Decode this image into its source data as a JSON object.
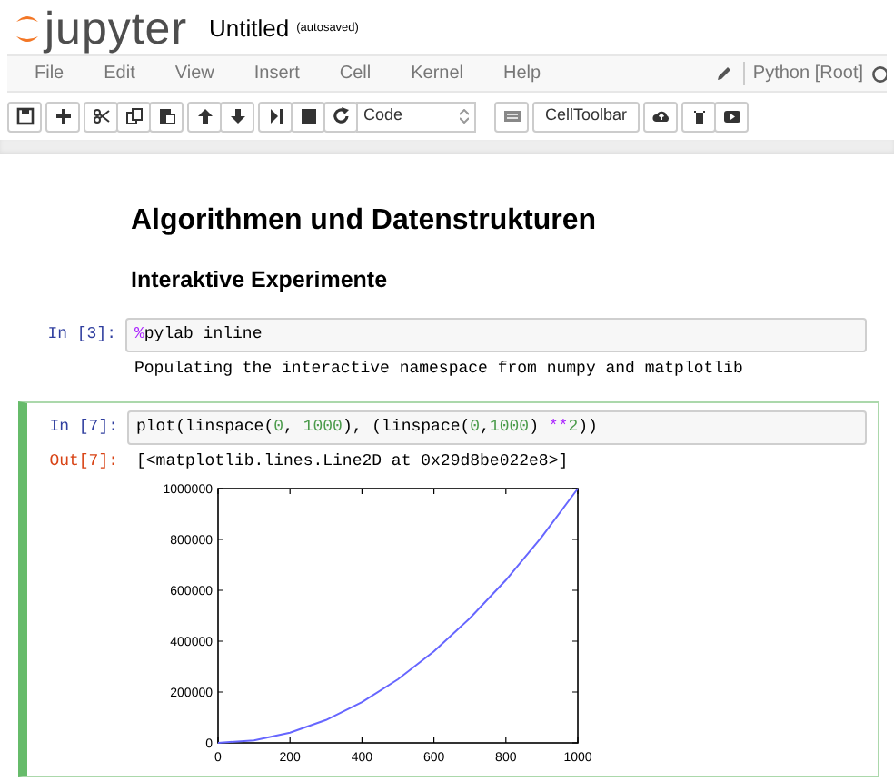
{
  "header": {
    "logo_text": "jupyter",
    "notebook_title": "Untitled",
    "save_status": "(autosaved)"
  },
  "menu": [
    "File",
    "Edit",
    "View",
    "Insert",
    "Cell",
    "Kernel",
    "Help"
  ],
  "kernel_name": "Python [Root]",
  "toolbar": {
    "cell_type": "Code",
    "cell_toolbar_button": "CellToolbar"
  },
  "cells": [
    {
      "kind": "heading1",
      "text": "Algorithmen und Datenstrukturen"
    },
    {
      "kind": "heading2",
      "text": "Interaktive Experimente"
    },
    {
      "kind": "code",
      "selected": false,
      "prompt": "In [3]:",
      "code": [
        {
          "kind": "magic",
          "text": "%"
        },
        {
          "kind": "plain",
          "text": "pylab inline"
        }
      ],
      "output": {
        "text": "Populating the interactive namespace from numpy and matplotlib"
      }
    },
    {
      "kind": "code",
      "selected": true,
      "prompt": "In [7]:",
      "code": [
        {
          "kind": "plain",
          "text": "plot(linspace("
        },
        {
          "kind": "number",
          "text": "0"
        },
        {
          "kind": "plain",
          "text": ", "
        },
        {
          "kind": "number",
          "text": "1000"
        },
        {
          "kind": "plain",
          "text": "), (linspace("
        },
        {
          "kind": "number",
          "text": "0"
        },
        {
          "kind": "plain",
          "text": ","
        },
        {
          "kind": "number",
          "text": "1000"
        },
        {
          "kind": "plain",
          "text": ") "
        },
        {
          "kind": "operator",
          "text": "**"
        },
        {
          "kind": "number",
          "text": "2"
        },
        {
          "kind": "plain",
          "text": "))"
        }
      ],
      "output": {
        "prompt": "Out[7]:",
        "text": "[<matplotlib.lines.Line2D at 0x29d8be022e8>]",
        "chart_data": {
          "type": "line",
          "x": [
            0,
            100,
            200,
            300,
            400,
            500,
            600,
            700,
            800,
            900,
            1000
          ],
          "series": [
            {
              "color": "#6666ff",
              "values": [
                0,
                10000,
                40000,
                90000,
                160000,
                250000,
                360000,
                490000,
                640000,
                810000,
                1000000
              ]
            }
          ],
          "xlim": [
            0,
            1000
          ],
          "ylim": [
            0,
            1000000
          ],
          "xticks": [
            0,
            200,
            400,
            600,
            800,
            1000
          ],
          "yticks": [
            0,
            200000,
            400000,
            600000,
            800000,
            1000000
          ]
        }
      }
    }
  ]
}
